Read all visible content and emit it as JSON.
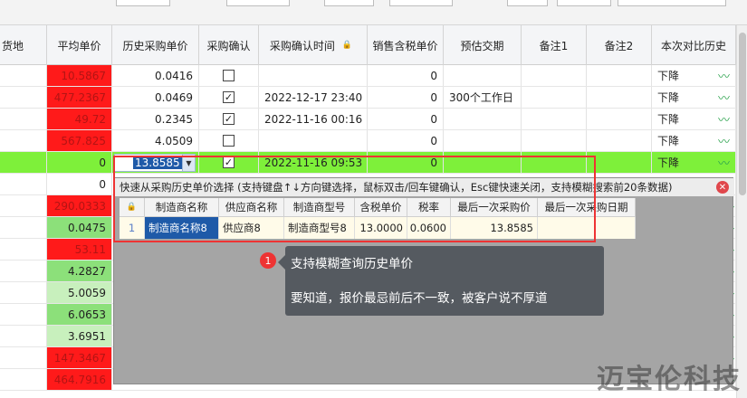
{
  "columns": [
    "货地",
    "平均单价",
    "历史采购单价",
    "采购确认",
    "采购确认时间",
    "销售含税单价",
    "预估交期",
    "备注1",
    "备注2",
    "本次对比历史"
  ],
  "rows": [
    {
      "avg": "10.5867",
      "avg_fill": "red",
      "hist": "0.0416",
      "confirmed": false,
      "time": "",
      "sale": "0",
      "lead": "",
      "compare": "下降"
    },
    {
      "avg": "477.2367",
      "avg_fill": "red",
      "hist": "0.0469",
      "confirmed": true,
      "time": "2022-12-17 23:40",
      "sale": "0",
      "lead": "300个工作日",
      "compare": "下降"
    },
    {
      "avg": "49.72",
      "avg_fill": "red",
      "hist": "0.2345",
      "confirmed": true,
      "time": "2022-11-16 00:16",
      "sale": "0",
      "lead": "",
      "compare": "下降"
    },
    {
      "avg": "567.825",
      "avg_fill": "red",
      "hist": "4.0509",
      "confirmed": false,
      "time": "",
      "sale": "0",
      "lead": "",
      "compare": "下降"
    },
    {
      "avg": "0",
      "avg_fill": "none",
      "hist": "13.8585",
      "confirmed": true,
      "time": "2022-11-16 09:53",
      "sale": "0",
      "lead": "",
      "compare": "下降",
      "selected": true
    },
    {
      "avg": "0",
      "avg_fill": "none"
    },
    {
      "avg": "290.0333",
      "avg_fill": "red"
    },
    {
      "avg": "0.0475",
      "avg_fill": "green"
    },
    {
      "avg": "53.11",
      "avg_fill": "red"
    },
    {
      "avg": "4.2827",
      "avg_fill": "green"
    },
    {
      "avg": "5.0059",
      "avg_fill": "light-green"
    },
    {
      "avg": "6.0653",
      "avg_fill": "green"
    },
    {
      "avg": "3.6951",
      "avg_fill": "light-green"
    },
    {
      "avg": "147.3467",
      "avg_fill": "red"
    },
    {
      "avg": "464.7916",
      "avg_fill": "red"
    }
  ],
  "popup": {
    "title": "快速从采购历史单价选择 (支持键盘↑↓方向键选择，鼠标双击/回车键确认，Esc键快速关闭，支持模糊搜索前20条数据)",
    "columns": [
      "制造商名称",
      "供应商名称",
      "制造商型号",
      "含税单价",
      "税率",
      "最后一次采购价",
      "最后一次采购日期"
    ],
    "row": {
      "index": "1",
      "maker": "制造商名称8",
      "supplier": "供应商8",
      "model": "制造商型号8",
      "price": "13.0000",
      "tax": "0.0600",
      "last_price": "13.8585",
      "last_date": ""
    }
  },
  "tooltip": {
    "badge": "1",
    "line1": "支持模糊查询历史单价",
    "line2": "要知道，报价最忌前后不一致，被客户说不厚道"
  },
  "watermark": "迈宝伦科技",
  "colors": {
    "red": "#ff1a1a",
    "green": "#8ce07a",
    "light_green": "#c8f0bd",
    "selected_row": "#7ef03a",
    "annotation": "#e33333"
  }
}
